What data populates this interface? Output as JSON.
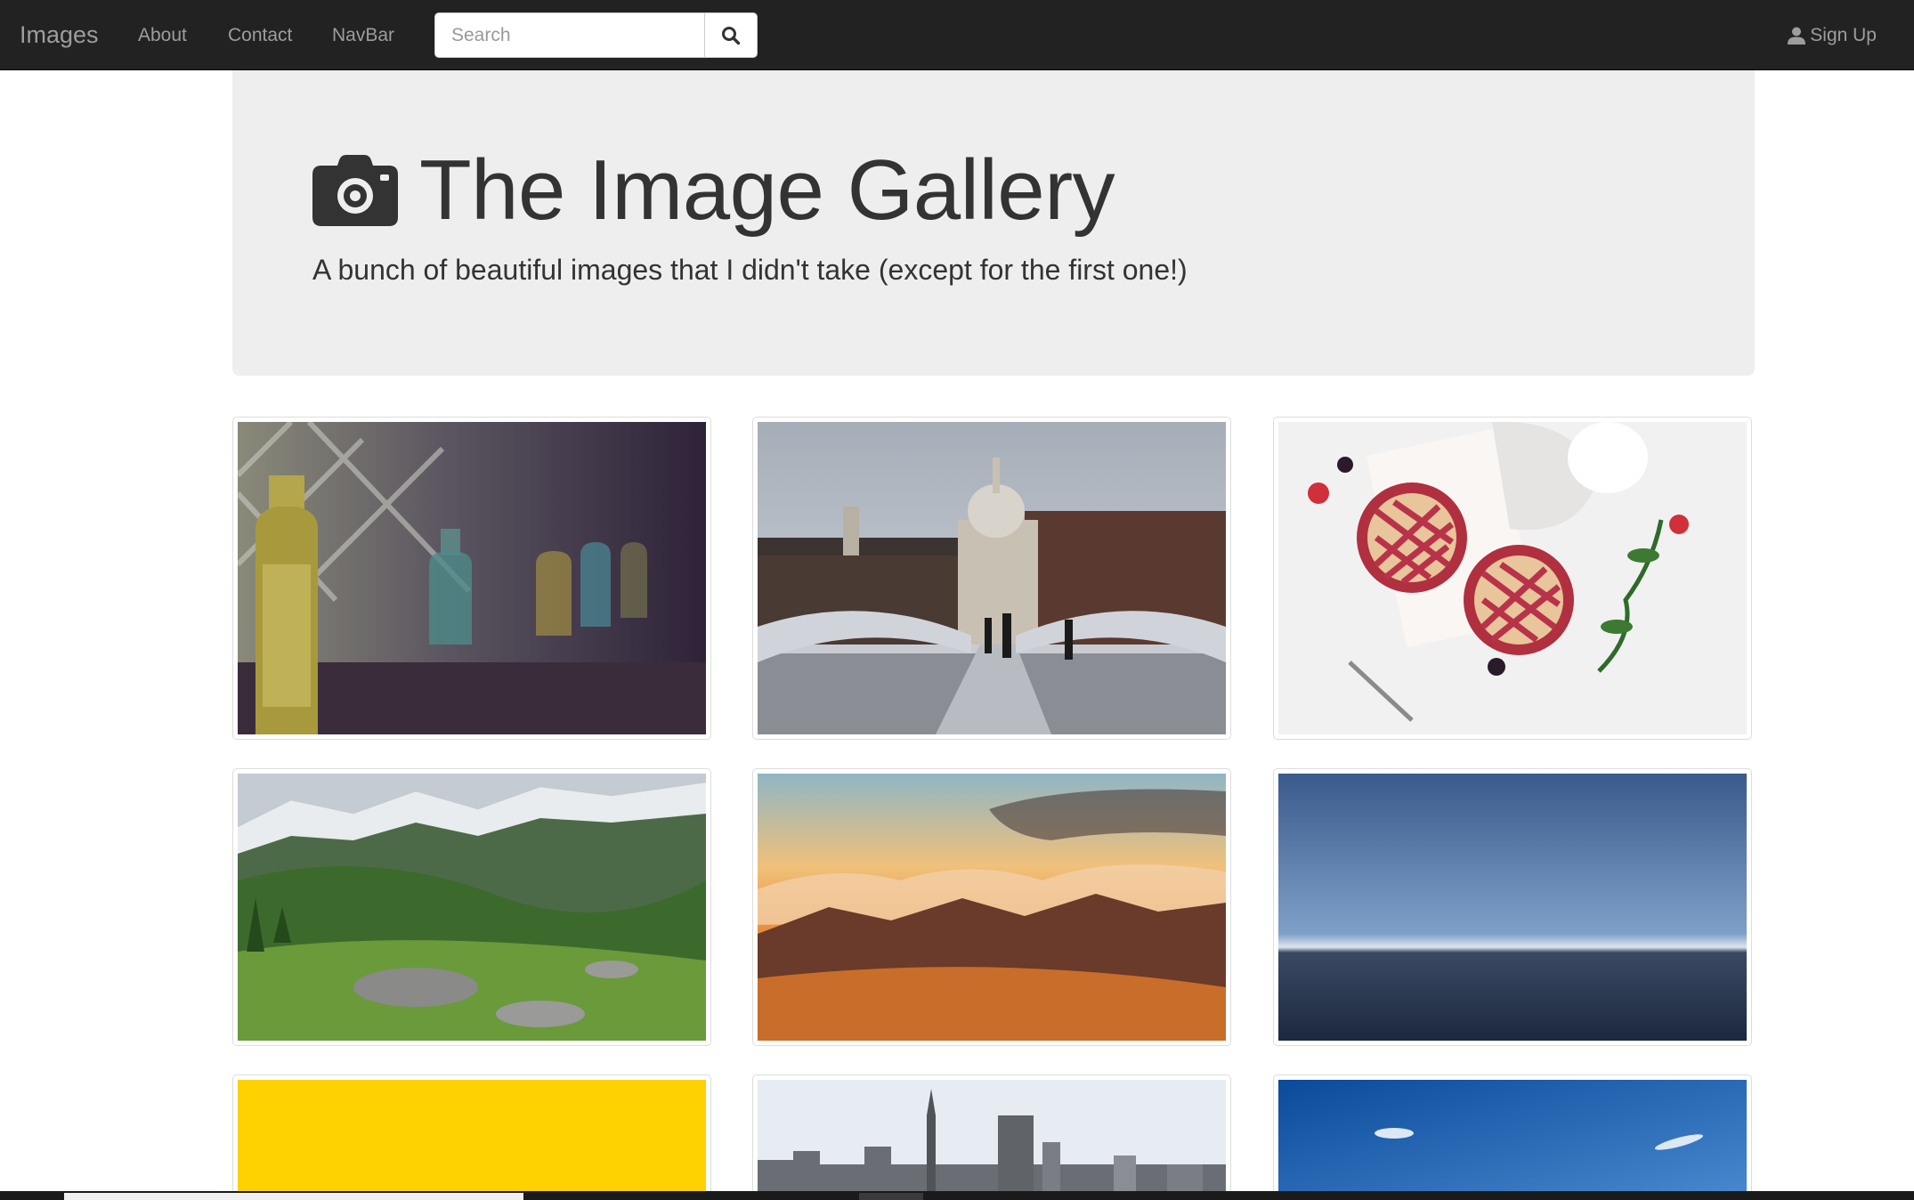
{
  "navbar": {
    "brand": "Images",
    "links": [
      "About",
      "Contact",
      "NavBar"
    ],
    "search": {
      "placeholder": "Search",
      "value": ""
    },
    "signup": "Sign Up"
  },
  "jumbotron": {
    "title": "The Image Gallery",
    "subtitle": "A bunch of beautiful images that I didn't take (except for the first one!)"
  },
  "gallery": [
    {
      "subject": "glass bottles on a windowsill"
    },
    {
      "subject": "bridge towards a domed cathedral"
    },
    {
      "subject": "berry pies on a white table"
    },
    {
      "subject": "green mountain valley with snow peaks"
    },
    {
      "subject": "orange sunset over clouds and mountains"
    },
    {
      "subject": "calm ocean horizon under blue sky"
    },
    {
      "subject": "yellow corrugated wall"
    },
    {
      "subject": "city skyline with tall towers"
    },
    {
      "subject": "blue sky with small clouds"
    }
  ],
  "colors": {
    "navbar": "#222222",
    "jumbotron": "#eeeeee",
    "nav_text": "#9d9d9d"
  }
}
